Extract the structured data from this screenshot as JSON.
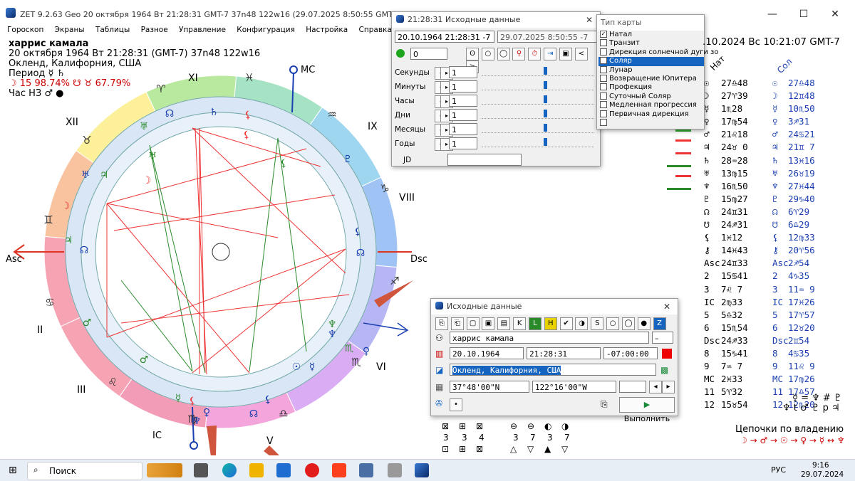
{
  "window": {
    "title": "ZET 9.2.63 Geo   20 октября 1964  Вт  21:28:31 GMT-7 37n48  122w16   (29.07.2025    8:50:55 GMT-7 38n35 121w30)",
    "minimize": "—",
    "maximize": "☐",
    "close": "✕"
  },
  "menu": [
    "Гороскоп",
    "Экраны",
    "Таблицы",
    "Разное",
    "Управление",
    "Конфигурация",
    "Настройка",
    "Справка"
  ],
  "chart_info": {
    "name": "харрис камала",
    "line1": "20 октября 1964   Вт   21:28:31 (GMT-7) 37n48   122w16",
    "line2": "Окленд, Калифорния, США",
    "line3": "Период ☿ ♄",
    "line4": "☽ 15 98.74%  ☋ ♉ 67.79%",
    "line5": "Час НЗ ♂ ●"
  },
  "wheel": {
    "labels": {
      "asc": "Asc",
      "dsc": "Dsc",
      "mc": "MC",
      "ic": "IC"
    },
    "houses": [
      "XII",
      "XI",
      "IX",
      "VIII",
      "VI",
      "V",
      "III",
      "II"
    ],
    "signs": {
      "aries": "♈",
      "taurus": "♉",
      "gemini": "♊",
      "cancer": "♋",
      "leo": "♌",
      "virgo": "♍",
      "libra": "♎",
      "scorpio": "♏",
      "sagittarius": "♐",
      "capricorn": "♑",
      "aquarius": "♒",
      "pisces": "♓"
    },
    "planets": {
      "sun": "☉",
      "moon": "☽",
      "mercury": "☿",
      "venus": "♀",
      "mars": "♂",
      "jupiter": "♃",
      "saturn": "♄",
      "uranus": "♅",
      "neptune": "♆",
      "pluto": "♇",
      "node": "☊",
      "lilith": "⚸"
    }
  },
  "source_panel": {
    "title": "21:28:31 Исходные данные",
    "date1": "20.10.1964  21:28:31  -7",
    "date2": "29.07.2025    8:50:55  -7",
    "counter": "0",
    "rows": [
      {
        "label": "Секунды",
        "value": "1",
        "thumb": 0.55
      },
      {
        "label": "Минуты",
        "value": "1",
        "thumb": 0.55
      },
      {
        "label": "Часы",
        "value": "1",
        "thumb": 0.55
      },
      {
        "label": "Дни",
        "value": "1",
        "thumb": 0.55
      },
      {
        "label": "Месяцы",
        "value": "1",
        "thumb": 0.55
      },
      {
        "label": "Годы",
        "value": "1",
        "thumb": 0.55
      }
    ],
    "jd": "JD",
    "nav_prev": "<",
    "nav_next": ">"
  },
  "chart_type": {
    "title": "Тип карты",
    "items": [
      {
        "label": "Натал",
        "checked": true
      },
      {
        "label": "Транзит",
        "checked": false
      },
      {
        "label": "Дирекция солнечной дуги зо",
        "checked": false
      },
      {
        "label": "Соляр",
        "checked": true,
        "selected": true
      },
      {
        "label": "Лунар",
        "checked": false
      },
      {
        "label": "Возвращение Юпитера",
        "checked": false
      },
      {
        "label": "Профекция",
        "checked": false
      },
      {
        "label": "Суточный Соляр",
        "checked": false
      },
      {
        "label": "Медленная прогрессия",
        "checked": false
      },
      {
        "label": "Первичная дирекция",
        "checked": false
      },
      {
        "label": "",
        "checked": false
      }
    ]
  },
  "right_header": ".10.2024  Вс  10:21:07 GMT-7",
  "col_headers": {
    "nat": "Нат",
    "sol": "Сол"
  },
  "positions": [
    {
      "s": "☉",
      "n": "27♎48",
      "t": "☉",
      "v": "27♎48"
    },
    {
      "s": "☽",
      "n": "27♈39",
      "t": "☽",
      "v": "12♊48"
    },
    {
      "s": "☿",
      "n": " 1♏28",
      "t": "☿",
      "v": "10♏50"
    },
    {
      "s": "♀",
      "n": "17♍54",
      "t": "♀",
      "v": " 3♐31"
    },
    {
      "s": "♂",
      "n": "21♌18",
      "t": "♂",
      "v": "24♋21"
    },
    {
      "s": "♃",
      "n": "24♉ 0",
      "t": "♃",
      "v": "21♊ 7"
    },
    {
      "s": "♄",
      "n": "28♒28",
      "t": "♄",
      "v": "13♓16"
    },
    {
      "s": "♅",
      "n": "13♍15",
      "t": "♅",
      "v": "26♉19"
    },
    {
      "s": "♆",
      "n": "16♏50",
      "t": "♆",
      "v": "27♓44"
    },
    {
      "s": "♇",
      "n": "15♍27",
      "t": "♇",
      "v": "29♑40"
    },
    {
      "s": "☊",
      "n": "24♊31",
      "t": "☊",
      "v": " 6♈29"
    },
    {
      "s": "☋",
      "n": "24♐31",
      "t": "☋",
      "v": " 6♎29"
    },
    {
      "s": "⚸",
      "n": " 1♓12",
      "t": "⚸",
      "v": "12♍33"
    },
    {
      "s": "⚷",
      "n": "14♓43",
      "t": "⚷",
      "v": "20♈56"
    },
    {
      "s": "Asc",
      "n": "24♊33",
      "t": "Asc",
      "v": " 2♐54"
    },
    {
      "s": "2",
      "n": "15♋41",
      "t": "2",
      "v": " 4♑35"
    },
    {
      "s": "3",
      "n": " 7♌ 7",
      "t": "3",
      "v": "11♒ 9"
    },
    {
      "s": "IC",
      "n": " 2♍33",
      "t": "IC",
      "v": "17♓26"
    },
    {
      "s": "5",
      "n": " 5♎32",
      "t": "5",
      "v": "17♈57"
    },
    {
      "s": "6",
      "n": "15♏54",
      "t": "6",
      "v": "12♉20"
    },
    {
      "s": "Dsc",
      "n": "24♐33",
      "t": "Dsc",
      "v": " 2♊54"
    },
    {
      "s": "8",
      "n": "15♑41",
      "t": "8",
      "v": " 4♋35"
    },
    {
      "s": "9",
      "n": " 7♒ 7",
      "t": "9",
      "v": "11♌ 9"
    },
    {
      "s": "MC",
      "n": " 2♓33",
      "t": "MC",
      "v": "17♍26"
    },
    {
      "s": "11",
      "n": " 5♈32",
      "t": "11",
      "v": "17♎57"
    },
    {
      "s": "12",
      "n": "15♉54",
      "t": "12",
      "v": "12♏20"
    }
  ],
  "rulers_line1": "☿ = ♆ # ♇",
  "rulers_line2": "♆ t ♂ ♇ p ♃",
  "chains_title": "Цепочки по владению",
  "chains_line": "☽ → ♂ → ☉ → ♀ → ☿ ↔ ♆",
  "input_panel": {
    "title": "Исходные данные",
    "name": "харрис камала",
    "date": "20.10.1964",
    "time": "21:28:31",
    "tz": "-07:00:00",
    "place": "Окленд, Калифорния, США",
    "lat": "37°48'00\"N",
    "lon": "122°16'00\"W",
    "execute": "Выполнить"
  },
  "bottom_counts": {
    "row1": [
      "3",
      "3",
      "4",
      "3",
      "7",
      "3",
      "7"
    ],
    "colors": {
      "accent": "#1565c0",
      "red": "#e53935",
      "green": "#2e7d32"
    }
  },
  "taskbar": {
    "search": "Поиск",
    "lang": "РУС",
    "time": "9:16",
    "date": "29.07.2024"
  }
}
